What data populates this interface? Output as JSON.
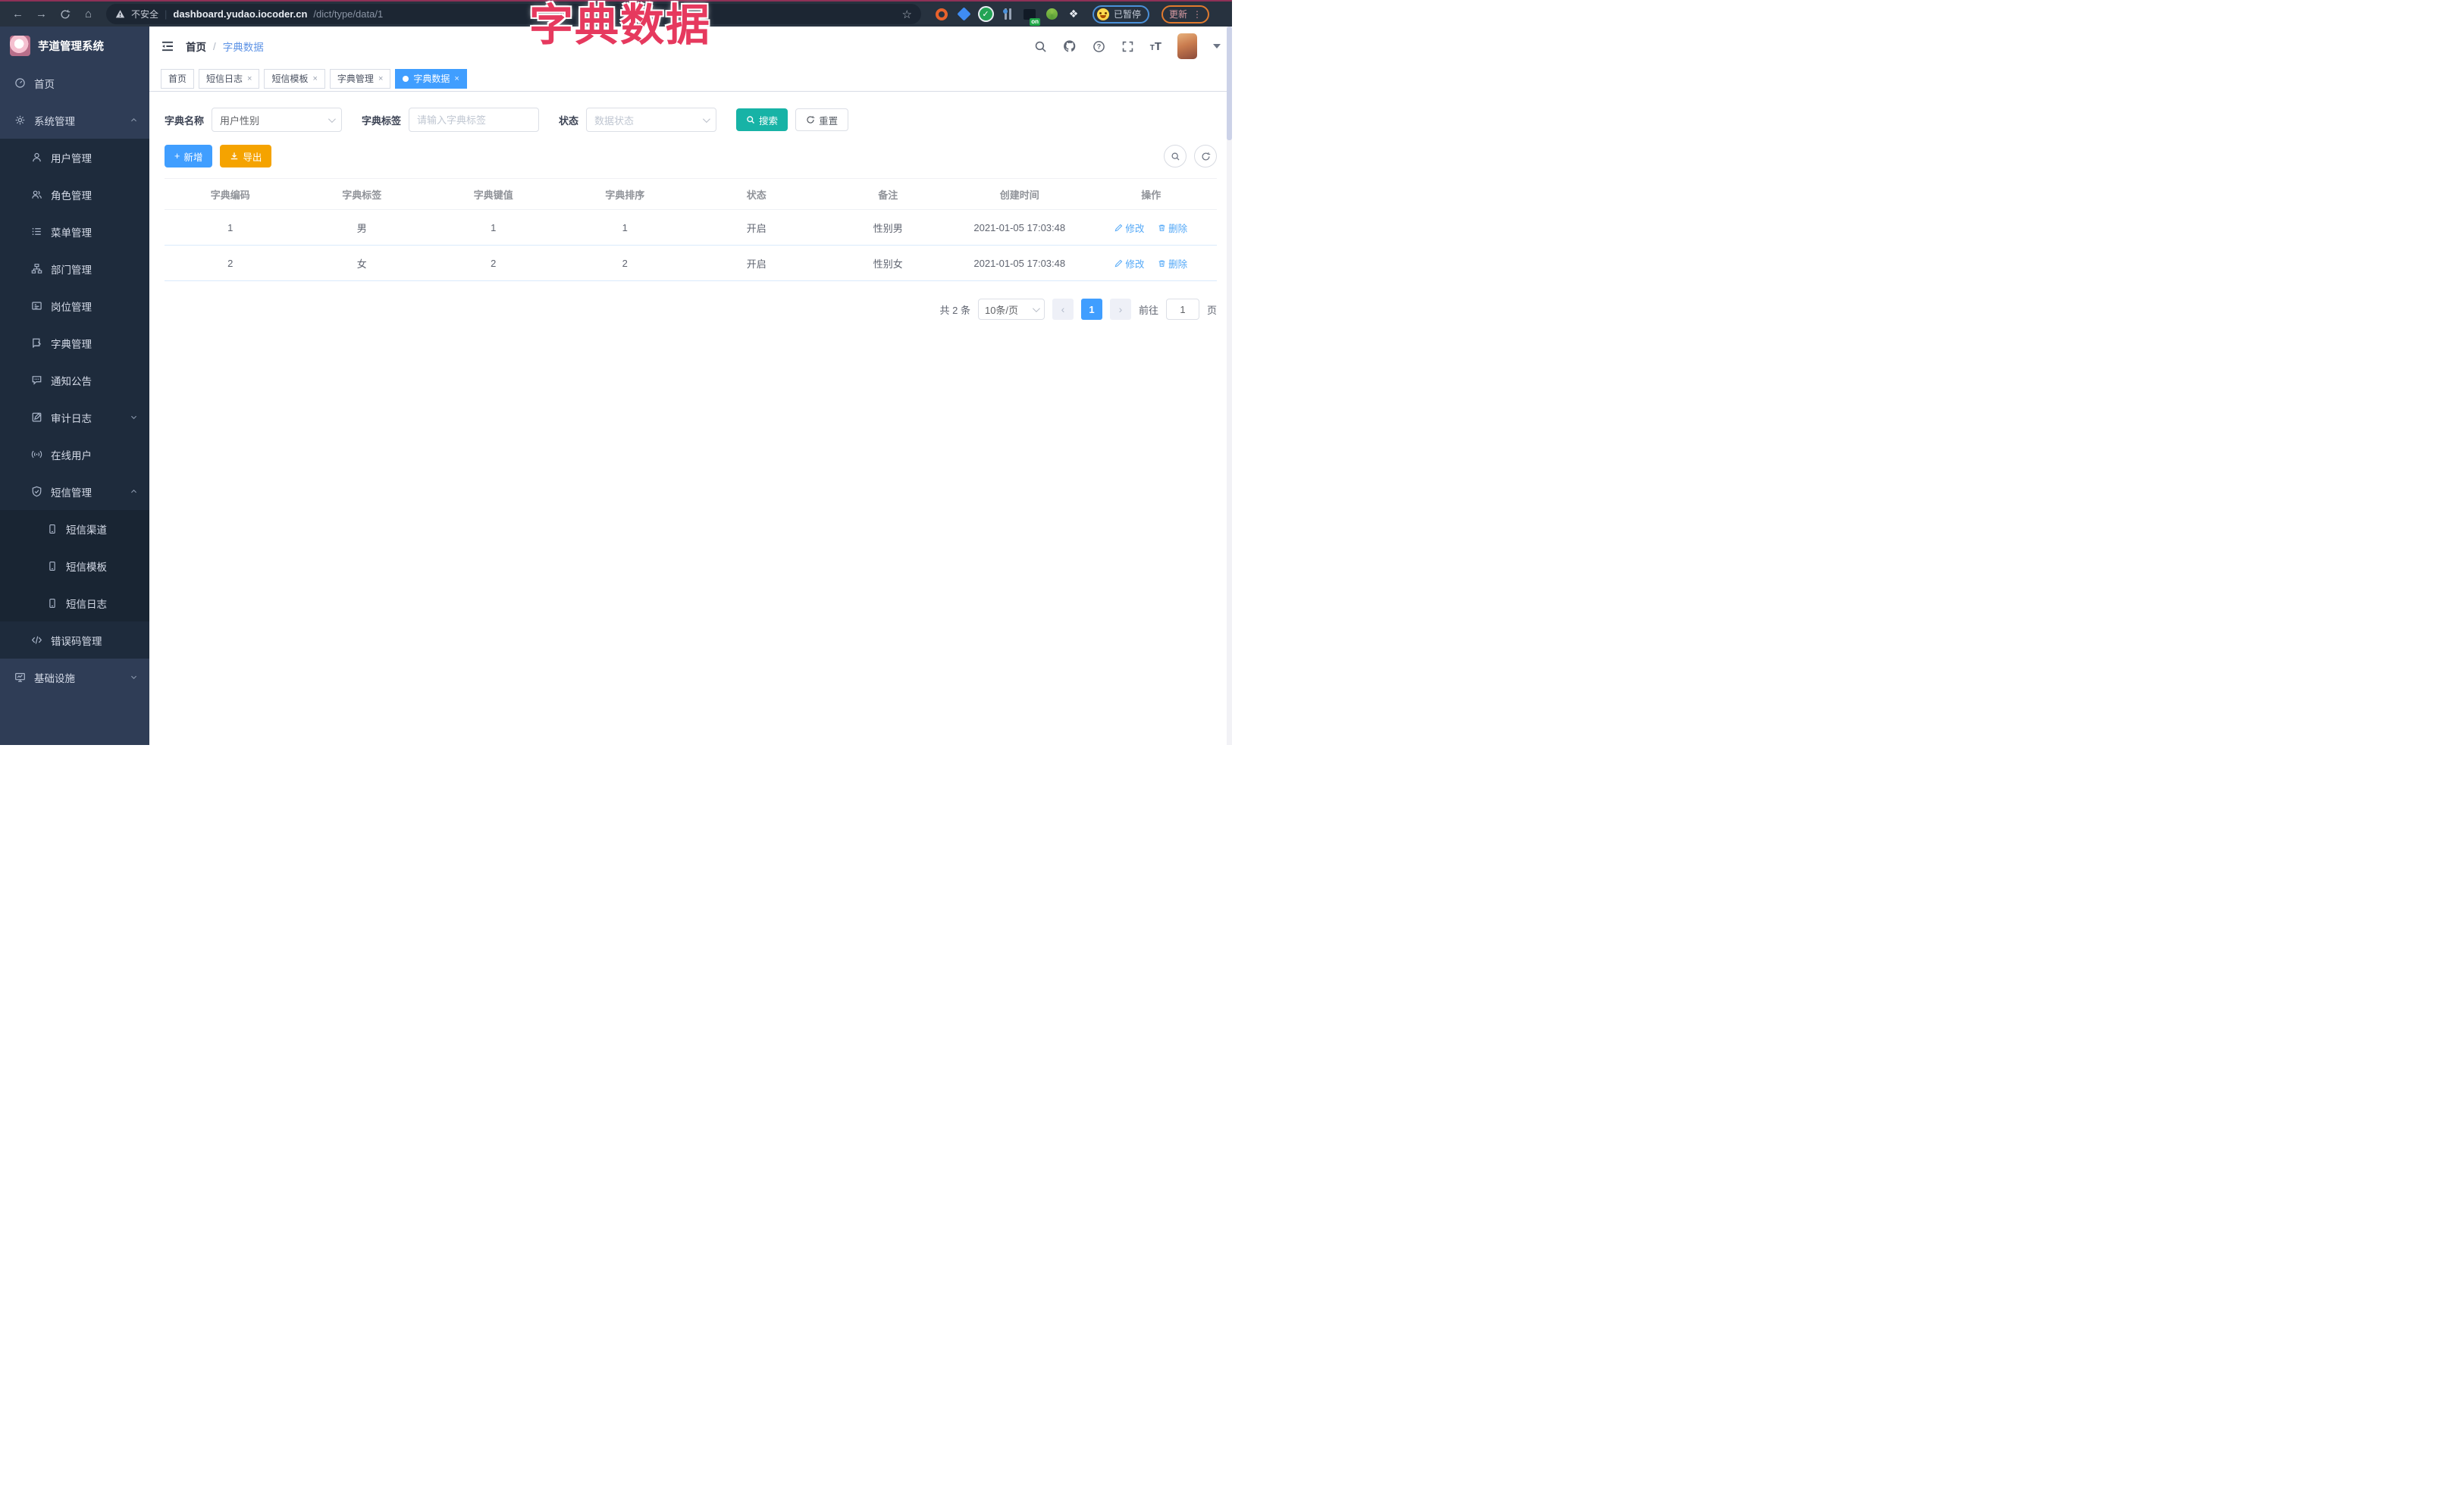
{
  "browser": {
    "security_label": "不安全",
    "url_host": "dashboard.yudao.iocoder.cn",
    "url_path": "/dict/type/data/1",
    "divider": "|",
    "paused_label": "已暂停",
    "update_label": "更新",
    "on_badge": "on"
  },
  "annotation": {
    "title": "字典数据"
  },
  "sidebar": {
    "logo_title": "芋道管理系统",
    "items": [
      {
        "label": "首页"
      },
      {
        "label": "系统管理"
      },
      {
        "label": "用户管理"
      },
      {
        "label": "角色管理"
      },
      {
        "label": "菜单管理"
      },
      {
        "label": "部门管理"
      },
      {
        "label": "岗位管理"
      },
      {
        "label": "字典管理"
      },
      {
        "label": "通知公告"
      },
      {
        "label": "审计日志"
      },
      {
        "label": "在线用户"
      },
      {
        "label": "短信管理"
      },
      {
        "label": "短信渠道"
      },
      {
        "label": "短信模板"
      },
      {
        "label": "短信日志"
      },
      {
        "label": "错误码管理"
      },
      {
        "label": "基础设施"
      }
    ]
  },
  "breadcrumb": {
    "home": "首页",
    "separator": "/",
    "current": "字典数据"
  },
  "tabs": {
    "items": [
      {
        "label": "首页"
      },
      {
        "label": "短信日志"
      },
      {
        "label": "短信模板"
      },
      {
        "label": "字典管理"
      },
      {
        "label": "字典数据"
      }
    ],
    "close_glyph": "×"
  },
  "filters": {
    "dict_name_label": "字典名称",
    "dict_name_value": "用户性别",
    "dict_label_label": "字典标签",
    "dict_label_placeholder": "请输入字典标签",
    "status_label": "状态",
    "status_placeholder": "数据状态",
    "search_label": "搜索",
    "reset_label": "重置"
  },
  "toolbar": {
    "add_label": "新增",
    "export_label": "导出"
  },
  "table": {
    "columns": [
      "字典编码",
      "字典标签",
      "字典键值",
      "字典排序",
      "状态",
      "备注",
      "创建时间",
      "操作"
    ],
    "rows": [
      {
        "cells": [
          "1",
          "男",
          "1",
          "1",
          "开启",
          "性别男",
          "2021-01-05 17:03:48"
        ]
      },
      {
        "cells": [
          "2",
          "女",
          "2",
          "2",
          "开启",
          "性别女",
          "2021-01-05 17:03:48"
        ]
      }
    ],
    "edit_label": "修改",
    "delete_label": "删除"
  },
  "pagination": {
    "total": "共 2 条",
    "page_size": "10条/页",
    "current_page": "1",
    "goto_label": "前往",
    "goto_value": "1",
    "page_unit": "页"
  },
  "colors": {
    "primary": "#409eff",
    "success_teal": "#17b3a6",
    "warning_orange": "#f5a300",
    "annotation_red": "#e6395e",
    "sidebar_bg": "#2f3d56",
    "sidebar_submenu_bg": "#1e2b3c"
  }
}
